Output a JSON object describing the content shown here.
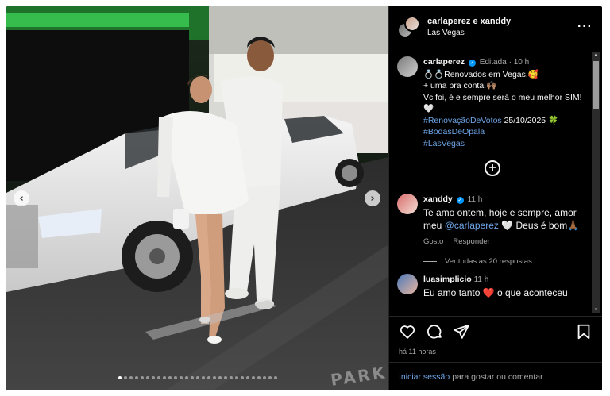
{
  "header": {
    "users": "carlaperez e xanddy",
    "location": "Las Vegas",
    "more_icon": "ellipsis-icon"
  },
  "caption": {
    "username": "carlaperez",
    "edited": "Editada",
    "time": "10 h",
    "lines": [
      "💍💍Renovados em Vegas.🥰",
      "+ uma pra conta.🙌🏽",
      "Vc foi, é e sempre será o meu melhor SIM!🤍"
    ],
    "hashtag1": "#RenovaçãoDeVotos",
    "date": "25/10/2025 🍀",
    "hashtag2": "#BodasDeOpala",
    "hashtag3": "#LasVegas"
  },
  "reply": {
    "username": "xanddy",
    "time": "11 h",
    "text_before": "Te amo ontem, hoje e sempre, amor meu ",
    "mention": "@carlaperez",
    "text_after": " 🤍 Deus é bom🙏🏾",
    "like_label": "Gosto",
    "reply_label": "Responder",
    "view_replies": "Ver todas as 20 respostas"
  },
  "next_comment": {
    "username": "luasimplicio",
    "time": "11 h",
    "text": "Eu amo tanto ❤️ o que aconteceu"
  },
  "actions": {
    "time_ago": "há 11 horas"
  },
  "login_bar": {
    "link": "Iniciar sessão",
    "text": "para gostar ou comentar"
  },
  "carousel": {
    "dot_count": 29,
    "active_index": 0,
    "watermark": "PARK"
  },
  "colors": {
    "accent_blue": "#0095f6",
    "link_blue": "#6ea6e8",
    "background": "#000000"
  }
}
